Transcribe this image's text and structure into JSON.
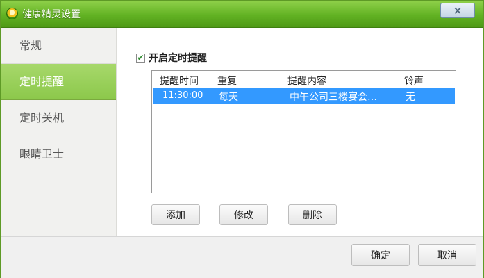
{
  "window": {
    "title": "健康精灵设置",
    "close_label": "×"
  },
  "sidebar": {
    "items": [
      {
        "label": "常规",
        "active": false
      },
      {
        "label": "定时提醒",
        "active": true
      },
      {
        "label": "定时关机",
        "active": false
      },
      {
        "label": "眼睛卫士",
        "active": false
      }
    ]
  },
  "reminder": {
    "enable_checked": true,
    "enable_label": "开启定时提醒",
    "columns": [
      "提醒时间",
      "重复",
      "提醒内容",
      "铃声"
    ],
    "rows": [
      {
        "time": "11:30:00",
        "repeat": "每天",
        "content": "中午公司三楼宴会…",
        "sound": "无",
        "selected": true
      }
    ],
    "buttons": {
      "add": "添加",
      "edit": "修改",
      "delete": "删除"
    }
  },
  "footer": {
    "ok": "确定",
    "cancel": "取消"
  },
  "colors": {
    "title_green": "#62b223",
    "nav_active": "#99cf5b",
    "selection_blue": "#3399ff"
  }
}
